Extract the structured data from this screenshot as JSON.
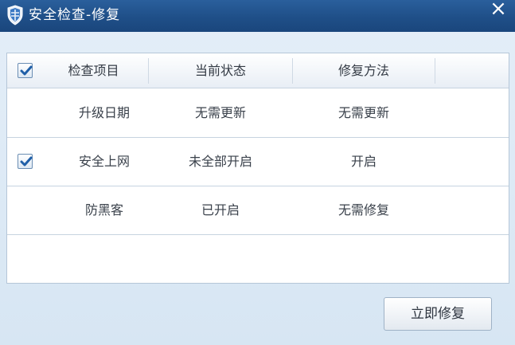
{
  "window": {
    "title": "安全检查-修复",
    "close_glyph": "×"
  },
  "table": {
    "select_all_checked": true,
    "columns": [
      "检查项目",
      "当前状态",
      "修复方法"
    ],
    "rows": [
      {
        "checked": false,
        "item": "升级日期",
        "status": "无需更新",
        "fix": "无需更新"
      },
      {
        "checked": true,
        "item": "安全上网",
        "status": "未全部开启",
        "fix": "开启"
      },
      {
        "checked": false,
        "item": "防黑客",
        "status": "已开启",
        "fix": "无需修复"
      }
    ]
  },
  "actions": {
    "repair_now_label": "立即修复"
  },
  "icons": {
    "app": "shield-icon",
    "close": "close-icon",
    "check": "checkmark-icon"
  },
  "colors": {
    "titlebar": "#1f4f88",
    "check": "#1f5fa8"
  }
}
